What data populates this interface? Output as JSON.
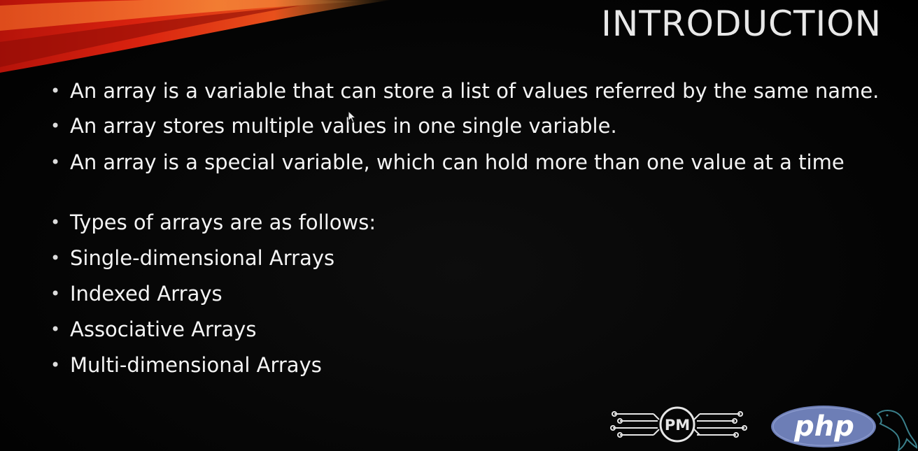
{
  "slide": {
    "title": "INTRODUCTION",
    "bullets": [
      "An array is a variable that can store a list of values referred by the same name.",
      "An array stores multiple values in one single variable.",
      "An array is a special variable, which can hold more than one value at a time",
      "Types of arrays are as follows:",
      "Single-dimensional Arrays",
      "Indexed Arrays",
      "Associative Arrays",
      "Multi-dimensional Arrays"
    ],
    "bullet_symbol": "•",
    "logos": {
      "pm_text": "PM",
      "php_text": "php"
    }
  },
  "colors": {
    "background": "#050505",
    "text": "#f2f2f2",
    "swoosh_red": "#c0180c",
    "swoosh_orange": "#e0601a",
    "php_blue": "#6d7eb6"
  }
}
